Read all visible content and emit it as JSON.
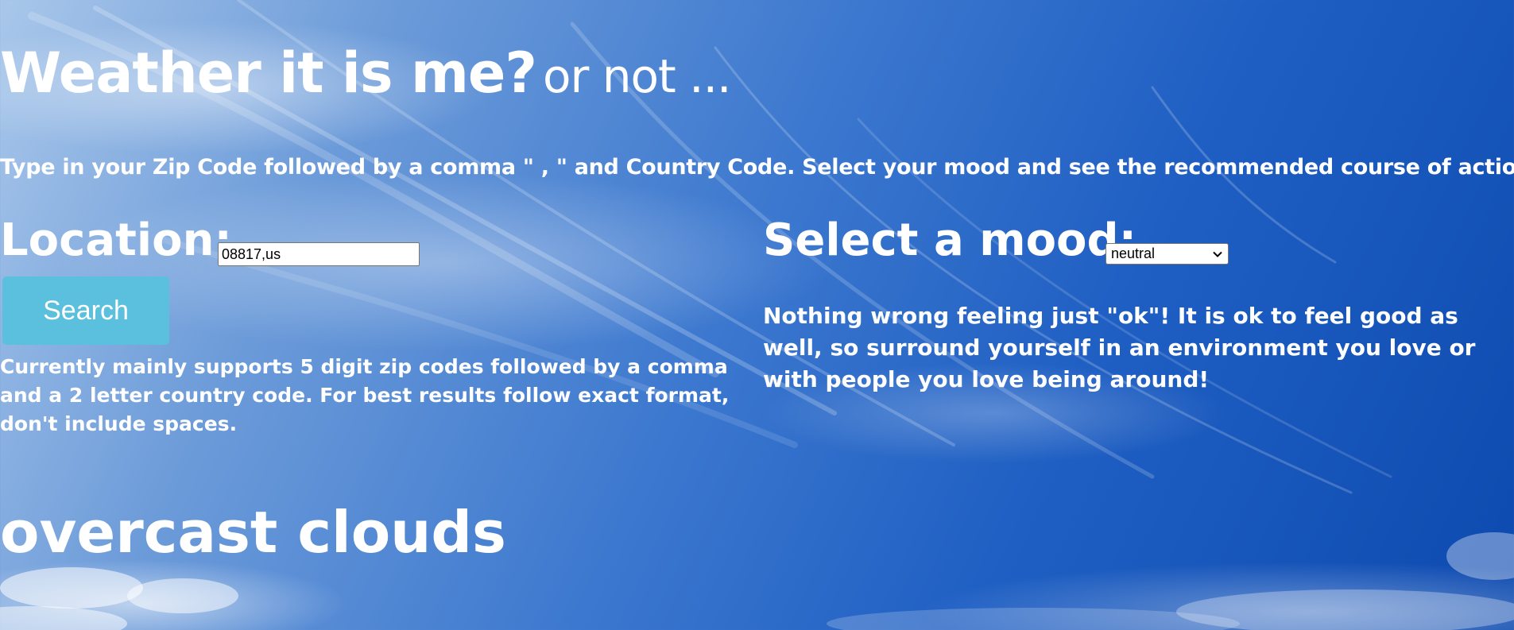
{
  "header": {
    "title": "Weather it is me?",
    "subtitle": "or not ..."
  },
  "instructions": "Type in your Zip Code followed by a comma \" , \" and Country Code. Select your mood and see the recommended course of action",
  "location": {
    "label": "Location:",
    "value": "08817,us",
    "search_label": "Search",
    "hint": "Currently mainly supports 5 digit zip codes followed by a comma and a 2 letter country code. For best results follow exact format, don't include spaces."
  },
  "mood": {
    "label": "Select a mood:",
    "selected": "neutral",
    "recommendation": "Nothing wrong feeling just \"ok\"! It is ok to feel good as well, so surround yourself in an environment you love or with people you love being around!"
  },
  "weather": {
    "description": "overcast clouds"
  },
  "icons": {
    "select_arrow": "chevron-down-icon"
  },
  "colors": {
    "sky_light": "#a9c7ea",
    "sky_dark": "#0d4aaf",
    "button": "#5bc0de",
    "text": "#ffffff"
  }
}
